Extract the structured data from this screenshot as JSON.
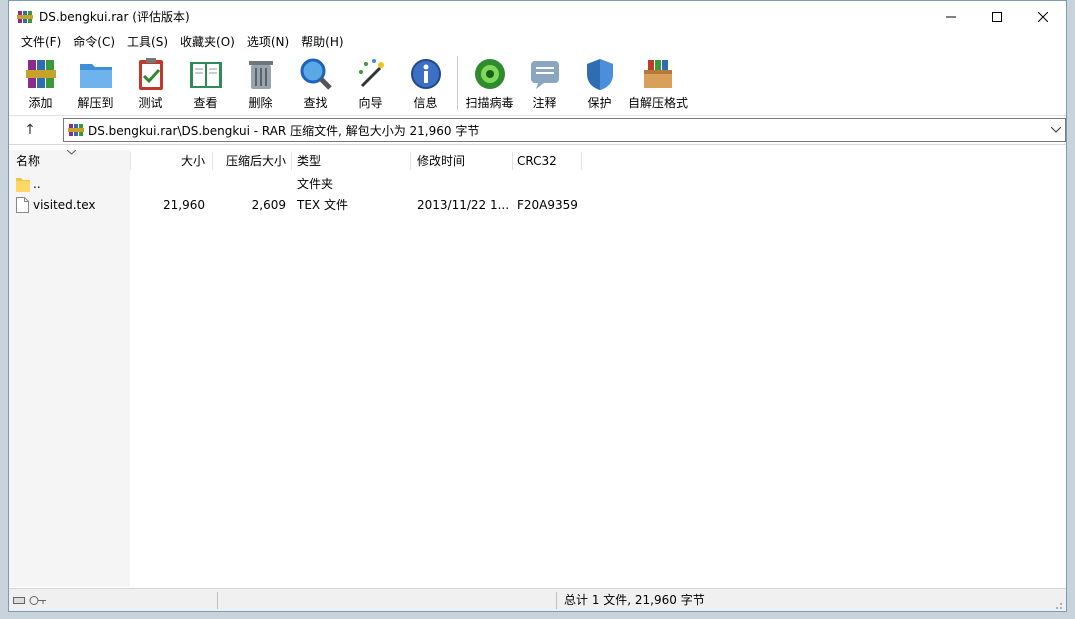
{
  "window": {
    "title": "DS.bengkui.rar (评估版本)",
    "minimize_glyph": "—",
    "maximize_glyph": "☐",
    "close_glyph": "✕"
  },
  "menu": [
    "文件(F)",
    "命令(C)",
    "工具(S)",
    "收藏夹(O)",
    "选项(N)",
    "帮助(H)"
  ],
  "toolbar": {
    "add": "添加",
    "extract_to": "解压到",
    "test": "测试",
    "view": "查看",
    "delete": "删除",
    "find": "查找",
    "wizard": "向导",
    "info": "信息",
    "virus_scan": "扫描病毒",
    "comment": "注释",
    "protect": "保护",
    "sfx": "自解压格式"
  },
  "address": {
    "up_glyph": "↑",
    "path": "DS.bengkui.rar\\DS.bengkui - RAR 压缩文件, 解包大小为 21,960 字节"
  },
  "columns": {
    "name": "名称",
    "size": "大小",
    "packed": "压缩后大小",
    "type": "类型",
    "modified": "修改时间",
    "crc": "CRC32"
  },
  "files": [
    {
      "name": "..",
      "size": "",
      "packed": "",
      "type": "文件夹",
      "modified": "",
      "crc": "",
      "icon": "folder-icon"
    },
    {
      "name": "visited.tex",
      "size": "21,960",
      "packed": "2,609",
      "type": "TEX 文件",
      "modified": "2013/11/22 1...",
      "crc": "F20A9359",
      "icon": "file-icon"
    }
  ],
  "status": {
    "summary": "总计 1 文件, 21,960 字节"
  },
  "colors": {
    "accent": "#1e63b8",
    "window_border": "#7a9ab8"
  }
}
